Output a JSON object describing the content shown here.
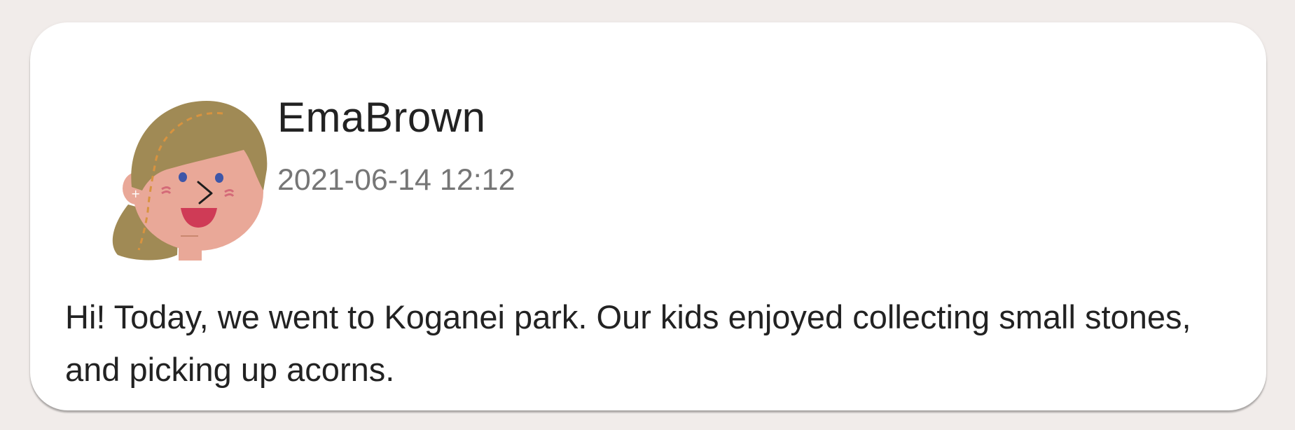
{
  "post": {
    "author": "EmaBrown",
    "timestamp": "2021-06-14 12:12",
    "body": "Hi! Today, we went to Koganei park. Our kids enjoyed collecting small stones, and picking up acorns.",
    "avatar_icon": "user-avatar-woman-icon"
  },
  "colors": {
    "page_background": "#f1ecea",
    "card_background": "#ffffff",
    "author_text": "#222222",
    "timestamp_text": "#767676",
    "body_text": "#222222",
    "avatar_hair": "#a08a55",
    "avatar_skin": "#e9a898",
    "avatar_mouth": "#cf3b56",
    "avatar_eyes": "#3d56a8"
  }
}
